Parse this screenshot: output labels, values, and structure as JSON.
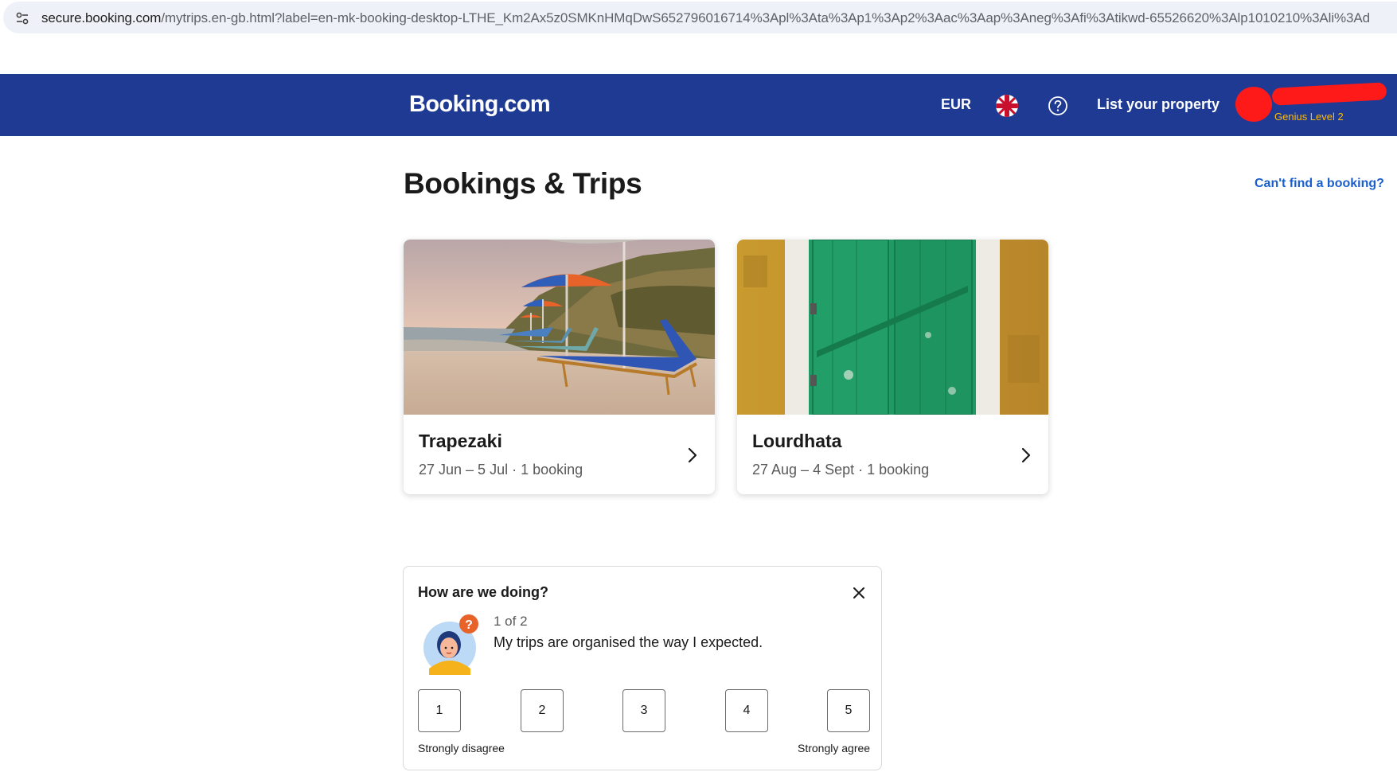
{
  "browser": {
    "url_host": "secure.booking.com",
    "url_rest": "/mytrips.en-gb.html?label=en-mk-booking-desktop-LTHE_Km2Ax5z0SMKnHMqDwS652796016714%3Apl%3Ata%3Ap1%3Ap2%3Aac%3Aap%3Aneg%3Afi%3Atikwd-65526620%3Alp1010210%3Ali%3Ad"
  },
  "header": {
    "logo": "Booking.com",
    "currency": "EUR",
    "flag_icon": "uk-flag-icon",
    "help_icon": "question-circle-icon",
    "list_property": "List your property",
    "genius": "Genius Level 2",
    "bg_color": "#1f3a93",
    "genius_color": "#febb02"
  },
  "page": {
    "title": "Bookings & Trips",
    "cant_find": "Can't find a booking?"
  },
  "trips": [
    {
      "name": "Trapezaki",
      "details": "27 Jun – 5 Jul · 1 booking"
    },
    {
      "name": "Lourdhata",
      "details": "27 Aug – 4 Sept · 1 booking"
    }
  ],
  "survey": {
    "title": "How are we doing?",
    "progress": "1 of 2",
    "question": "My trips are organised the way I expected.",
    "ratings": [
      "1",
      "2",
      "3",
      "4",
      "5"
    ],
    "low_label": "Strongly disagree",
    "high_label": "Strongly agree"
  }
}
